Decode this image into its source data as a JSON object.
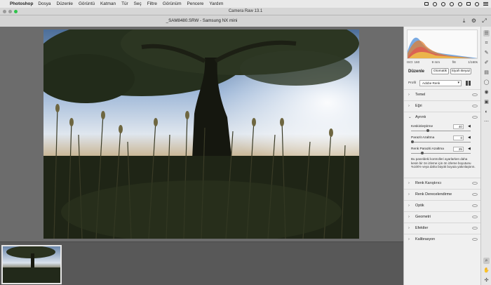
{
  "menubar": {
    "app": "Photoshop",
    "items": [
      "Dosya",
      "Düzenle",
      "Görüntü",
      "Katman",
      "Tür",
      "Seç",
      "Filtre",
      "Görünüm",
      "Pencere",
      "Yardım"
    ]
  },
  "window": {
    "title": "Camera Raw 13.1"
  },
  "header": {
    "filename": "_SAM8480.SRW  -  Samsung NX mini"
  },
  "camera_info": {
    "iso": "ISO: 160",
    "focal": "9 mm",
    "aperture": "f/8",
    "shutter": "1/160s"
  },
  "edit_panel": {
    "title": "Düzenle",
    "auto_label": "Otomatik",
    "bw_label": "Siyah Beyaz",
    "profile_label": "Profil",
    "profile_value": "Adobe Renk"
  },
  "sections_top": [
    "Temel",
    "Eğri"
  ],
  "detail": {
    "label": "Ayrıntı",
    "sliders": [
      {
        "label": "Keskinleştirme",
        "value": "40"
      },
      {
        "label": "Parazit Azaltma",
        "value": "0"
      },
      {
        "label": "Renk Paraziti Azaltma",
        "value": "25"
      }
    ],
    "info": "Bu paneldeki kontrolleri ayarlarken daha kesin bir ön izleme için ön izleme boyutunu %100'e veya daha büyük boyuta yakınlaştırın."
  },
  "sections_bottom": [
    "Renk Karıştırıcı",
    "Renk Derecelendirme",
    "Optik",
    "Geometri",
    "Efektler",
    "Kalibrasyon"
  ],
  "icons": {
    "toolbar": [
      "sliders-icon",
      "crop-icon",
      "heal-icon",
      "brush-icon",
      "gradient-icon",
      "radial-icon",
      "redeye-icon",
      "snapshot-icon",
      "presets-icon",
      "more-icon",
      "zoom-icon",
      "hand-icon",
      "sampler-icon"
    ]
  }
}
